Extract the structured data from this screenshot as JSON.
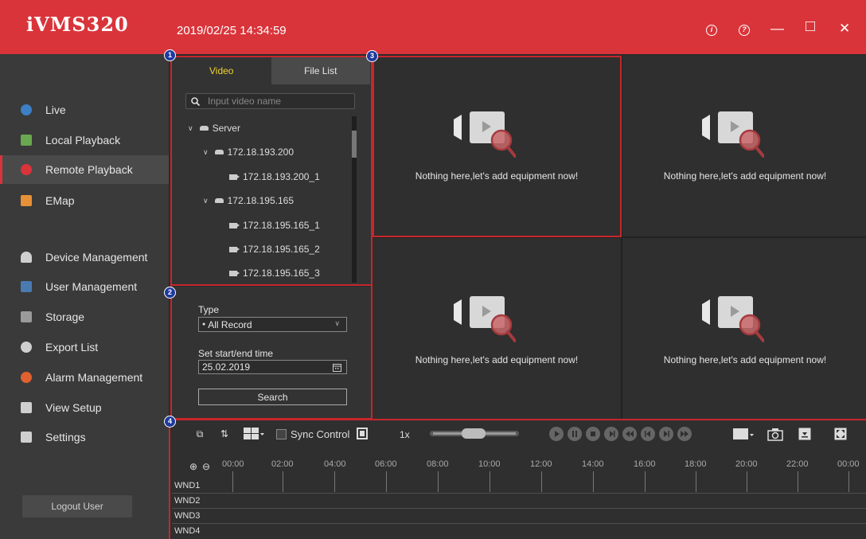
{
  "app": {
    "title": "iVMS320",
    "datetime": "2019/02/25 14:34:59",
    "accent_color": "#d9343a"
  },
  "window_controls": [
    {
      "name": "info-icon",
      "glyph": "i"
    },
    {
      "name": "help-icon",
      "glyph": "?"
    },
    {
      "name": "minimize-icon",
      "glyph": "—"
    },
    {
      "name": "maximize-icon",
      "glyph": "□"
    },
    {
      "name": "close-icon",
      "glyph": "✕"
    }
  ],
  "sidebar": {
    "items": [
      {
        "label": "Live",
        "icon": "live-icon"
      },
      {
        "label": "Local Playback",
        "icon": "local-playback-icon"
      },
      {
        "label": "Remote Playback",
        "icon": "remote-playback-icon",
        "active": true
      },
      {
        "label": "EMap",
        "icon": "emap-icon"
      },
      {
        "label": "Device Management",
        "icon": "device-icon"
      },
      {
        "label": "User Management",
        "icon": "user-icon"
      },
      {
        "label": "Storage",
        "icon": "storage-icon"
      },
      {
        "label": "Export List",
        "icon": "export-icon"
      },
      {
        "label": "Alarm Management",
        "icon": "alarm-icon"
      },
      {
        "label": "View Setup",
        "icon": "view-setup-icon"
      },
      {
        "label": "Settings",
        "icon": "settings-icon"
      }
    ],
    "logout_label": "Logout User"
  },
  "markers": [
    "1",
    "2",
    "3",
    "4"
  ],
  "device_panel": {
    "tabs": [
      {
        "label": "Video",
        "active": true
      },
      {
        "label": "File List",
        "active": false
      }
    ],
    "search_placeholder": "Input video name",
    "tree": [
      {
        "label": "Server",
        "type": "server"
      },
      {
        "label": "172.18.193.200",
        "type": "server"
      },
      {
        "label": "172.18.193.200_1",
        "type": "camera"
      },
      {
        "label": "172.18.195.165",
        "type": "server"
      },
      {
        "label": "172.18.195.165_1",
        "type": "camera"
      },
      {
        "label": "172.18.195.165_2",
        "type": "camera"
      },
      {
        "label": "172.18.195.165_3",
        "type": "camera"
      }
    ]
  },
  "search_panel": {
    "type_label": "Type",
    "type_value": "All Record",
    "time_label": "Set start/end time",
    "date_value": "25.02.2019",
    "search_label": "Search"
  },
  "video_grid": {
    "empty_message": "Nothing here,let's add equipment now!"
  },
  "playback_bar": {
    "sync_label": "Sync Control",
    "speed": "1x"
  },
  "timeline": {
    "ticks": [
      "00:00",
      "02:00",
      "04:00",
      "06:00",
      "08:00",
      "10:00",
      "12:00",
      "14:00",
      "16:00",
      "18:00",
      "20:00",
      "22:00",
      "00:00"
    ],
    "windows": [
      "WND1",
      "WND2",
      "WND3",
      "WND4"
    ]
  }
}
